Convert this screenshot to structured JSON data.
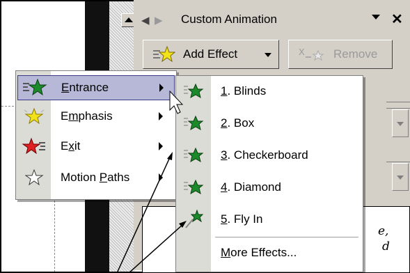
{
  "task_pane": {
    "title": "Custom Animation",
    "add_effect_label": "Add Effect",
    "remove_label": "Remove"
  },
  "effect_menu": {
    "items": [
      {
        "label_pre": "",
        "label_ul": "E",
        "label_post": "ntrance",
        "icon": "entrance-star-icon"
      },
      {
        "label_pre": "E",
        "label_ul": "m",
        "label_post": "phasis",
        "icon": "emphasis-star-icon"
      },
      {
        "label_pre": "E",
        "label_ul": "x",
        "label_post": "it",
        "icon": "exit-star-icon"
      },
      {
        "label_pre": "Motion ",
        "label_ul": "P",
        "label_post": "aths",
        "icon": "motion-paths-star-icon"
      }
    ]
  },
  "entrance_submenu": {
    "items": [
      {
        "num": "1",
        "post": ". Blinds"
      },
      {
        "num": "2",
        "post": ". Box"
      },
      {
        "num": "3",
        "post": ". Checkerboard"
      },
      {
        "num": "4",
        "post": ". Diamond"
      },
      {
        "num": "5",
        "post": ". Fly In"
      }
    ],
    "more_pre": "",
    "more_ul": "M",
    "more_post": "ore Effects..."
  },
  "slide_list_fragments": [
    "e,",
    "d"
  ],
  "colors": {
    "highlight": "#b7b8d8",
    "highlight_border": "#3a3a86",
    "entrance_star": "#1a8a2a",
    "emphasis_star": "#f2e21a",
    "exit_star": "#e02020"
  }
}
